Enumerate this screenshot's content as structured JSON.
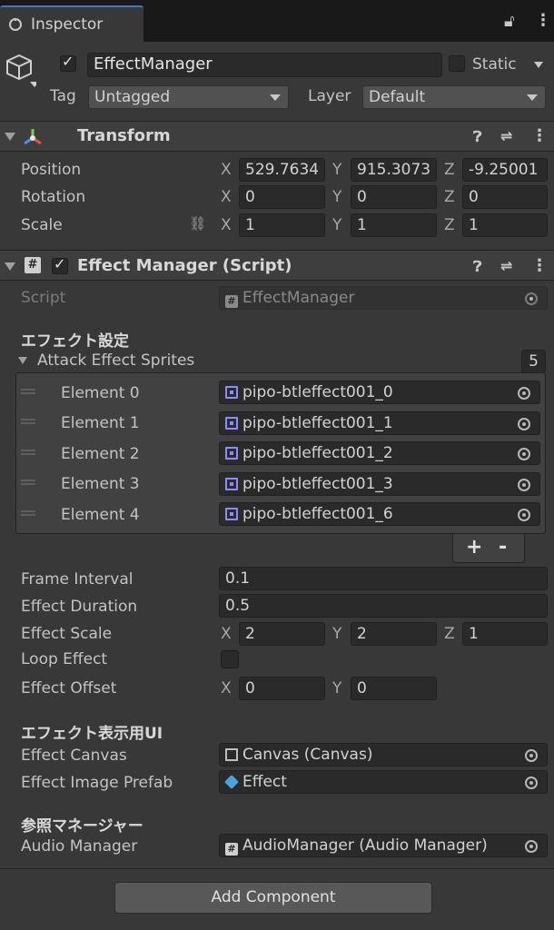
{
  "tab": {
    "title": "Inspector"
  },
  "object": {
    "name": "EffectManager",
    "static_label": "Static",
    "active": true
  },
  "tag": {
    "label": "Tag",
    "value": "Untagged"
  },
  "layer": {
    "label": "Layer",
    "value": "Default"
  },
  "transform": {
    "title": "Transform",
    "position": {
      "label": "Position",
      "x": "529.7634",
      "y": "915.3073",
      "z": "-9.25001"
    },
    "rotation": {
      "label": "Rotation",
      "x": "0",
      "y": "0",
      "z": "0"
    },
    "scale": {
      "label": "Scale",
      "x": "1",
      "y": "1",
      "z": "1"
    }
  },
  "axes": {
    "x": "X",
    "y": "Y",
    "z": "Z"
  },
  "script_component": {
    "title": "Effect Manager (Script)",
    "enabled": true,
    "script_label": "Script",
    "script_value": "EffectManager"
  },
  "section1": {
    "title": "エフェクト設定"
  },
  "list": {
    "label": "Attack Effect Sprites",
    "count": "5",
    "elements": [
      {
        "label": "Element 0",
        "value": "pipo-btleffect001_0"
      },
      {
        "label": "Element 1",
        "value": "pipo-btleffect001_1"
      },
      {
        "label": "Element 2",
        "value": "pipo-btleffect001_2"
      },
      {
        "label": "Element 3",
        "value": "pipo-btleffect001_3"
      },
      {
        "label": "Element 4",
        "value": "pipo-btleffect001_6"
      }
    ],
    "add": "+",
    "remove": "-"
  },
  "props": {
    "frame_interval": {
      "label": "Frame Interval",
      "value": "0.1"
    },
    "effect_duration": {
      "label": "Effect Duration",
      "value": "0.5"
    },
    "effect_scale": {
      "label": "Effect Scale",
      "x": "2",
      "y": "2",
      "z": "1"
    },
    "loop_effect": {
      "label": "Loop Effect",
      "checked": false
    },
    "effect_offset": {
      "label": "Effect Offset",
      "x": "0",
      "y": "0"
    }
  },
  "section2": {
    "title": "エフェクト表示用UI"
  },
  "ui": {
    "effect_canvas": {
      "label": "Effect Canvas",
      "value": "Canvas (Canvas)"
    },
    "effect_image_prefab": {
      "label": "Effect Image Prefab",
      "value": "Effect"
    }
  },
  "section3": {
    "title": "参照マネージャー"
  },
  "audio_manager": {
    "label": "Audio Manager",
    "value": "AudioManager (Audio Manager)"
  },
  "add_component": "Add Component",
  "colors": {
    "background": "#383838",
    "field": "#2a2a2a",
    "accent": "#3a79bb",
    "sprite_icon": "#8c8cff",
    "prefab_icon": "#4aa3e0"
  }
}
